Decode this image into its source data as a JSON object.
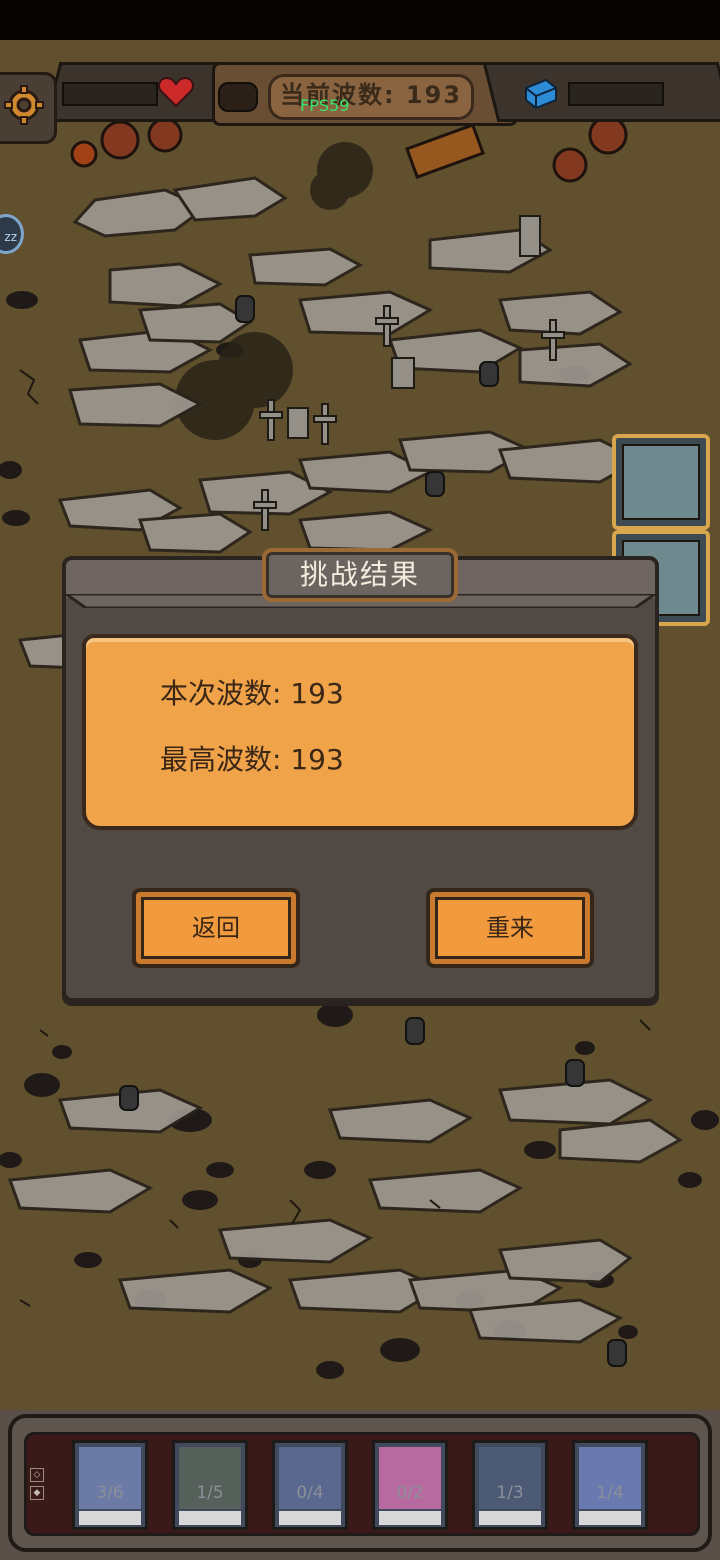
{
  "hud": {
    "current_wave_label": "当前波数: 193",
    "fps": "FPS59",
    "sleep_label": "zz"
  },
  "dialog": {
    "title": "挑战结果",
    "current_wave": "本次波数: 193",
    "best_wave": "最高波数: 193",
    "back_label": "返回",
    "retry_label": "重来"
  },
  "units": [
    {
      "count": "3/6",
      "color": "#6c7aa6"
    },
    {
      "count": "1/5",
      "color": "#55605a"
    },
    {
      "count": "0/4",
      "color": "#5a6890"
    },
    {
      "count": "0/2",
      "color": "#b76aa0"
    },
    {
      "count": "1/3",
      "color": "#4d5a76"
    },
    {
      "count": "1/4",
      "color": "#6a7ab0"
    }
  ],
  "colors": {
    "ground": "#86703f",
    "dialog": "#504944",
    "card": "#f0a349",
    "button": "#f19a3e",
    "fps": "#37e36b"
  }
}
